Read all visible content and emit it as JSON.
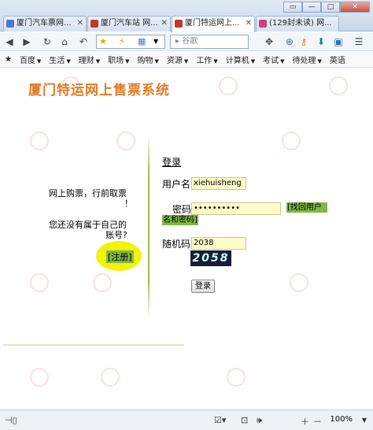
{
  "window": {
    "controls": [
      "▭",
      "—",
      "□",
      "✕"
    ]
  },
  "tabs": [
    {
      "label": "厦门汽车票网...",
      "color": "#4a7ad0"
    },
    {
      "label": "厦门汽车站 网...",
      "color": "#c0392b"
    },
    {
      "label": "厦门特运网上...",
      "color": "#c0392b"
    },
    {
      "label": "(129封未读) 网...",
      "color": "#d04080"
    }
  ],
  "toolbar": {
    "search_placeholder": "谷歌"
  },
  "bookmarks": [
    "百度",
    "生活",
    "理财",
    "职场",
    "购物",
    "资源",
    "工作",
    "计算机",
    "考试",
    "待处理",
    "英语"
  ],
  "page": {
    "title": "厦门特运网上售票系统",
    "left_line1": "网上购票，行前取票",
    "left_line1b": "！",
    "left_line2": "您还没有属于自己的",
    "left_line2b": "账号?",
    "register_link": "[注册]",
    "login_heading": "登录",
    "username_label": "用户名",
    "username_value": "xiehuisheng",
    "password_label": "密码",
    "password_value": "••••••••••",
    "find_link_line1": "[找回用户",
    "find_link_line2": "名和密码]",
    "captcha_label": "随机码",
    "captcha_input_value": "2038",
    "captcha_image_text": "2058",
    "login_button": "登录"
  },
  "statusbar": {
    "zoom": "100%"
  },
  "colors": {
    "title": "#e07a26",
    "link_bg": "#7fb845",
    "highlight": "#f2f20a",
    "input_bg": "#fcfcc8"
  }
}
